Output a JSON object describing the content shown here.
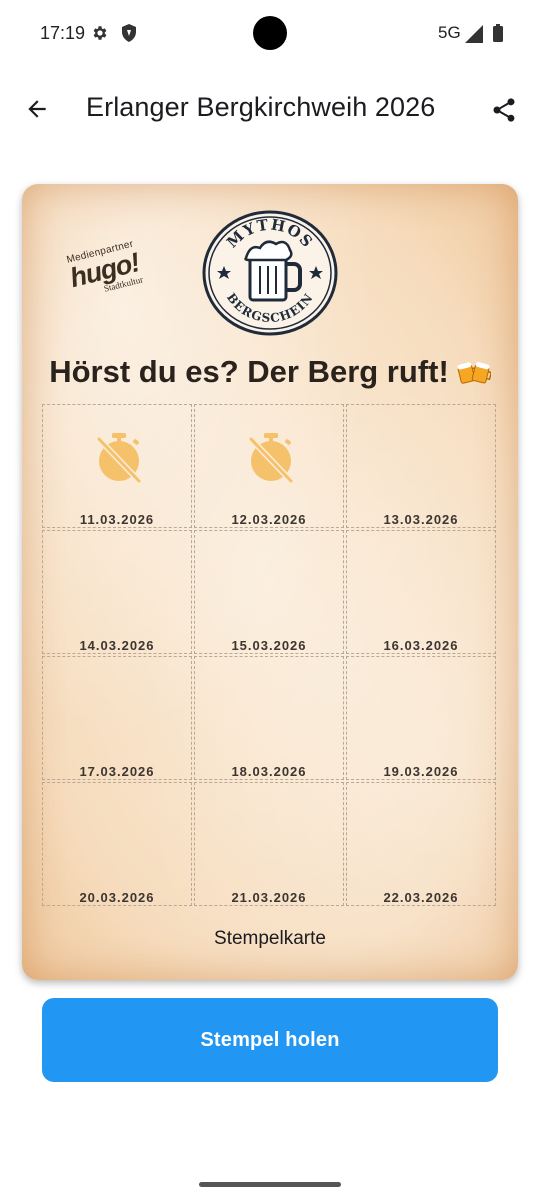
{
  "status_bar": {
    "time": "17:19",
    "network": "5G",
    "icons": [
      "gear-icon",
      "shield-icon",
      "signal-icon",
      "battery-icon"
    ]
  },
  "app_bar": {
    "title": "Erlanger Bergkirchweih 2026",
    "back_icon": "arrow-left-icon",
    "share_icon": "share-icon"
  },
  "card": {
    "sponsor": {
      "top": "Medienpartner",
      "main": "hugo!",
      "bottom": "Stadtkultur"
    },
    "badge": {
      "top_text": "MYTHOS",
      "bottom_text": "BERGSCHEIN",
      "icon": "beer-mug-icon"
    },
    "headline": "Hörst du es? Der Berg ruft!",
    "headline_icon": "clinking-beer-mugs-icon",
    "caption": "Stempelkarte",
    "missed_icon": "timer-off-icon",
    "stamps": [
      {
        "date": "11.03.2026",
        "status": "missed"
      },
      {
        "date": "12.03.2026",
        "status": "missed"
      },
      {
        "date": "13.03.2026",
        "status": "open"
      },
      {
        "date": "14.03.2026",
        "status": "open"
      },
      {
        "date": "15.03.2026",
        "status": "open"
      },
      {
        "date": "16.03.2026",
        "status": "open"
      },
      {
        "date": "17.03.2026",
        "status": "open"
      },
      {
        "date": "18.03.2026",
        "status": "open"
      },
      {
        "date": "19.03.2026",
        "status": "open"
      },
      {
        "date": "20.03.2026",
        "status": "open"
      },
      {
        "date": "21.03.2026",
        "status": "open"
      },
      {
        "date": "22.03.2026",
        "status": "open"
      }
    ]
  },
  "primary_button": {
    "label": "Stempel holen",
    "color": "#2196f3"
  },
  "colors": {
    "missed_icon": "#f5c26b",
    "card_paper": "#f6dcbd"
  }
}
